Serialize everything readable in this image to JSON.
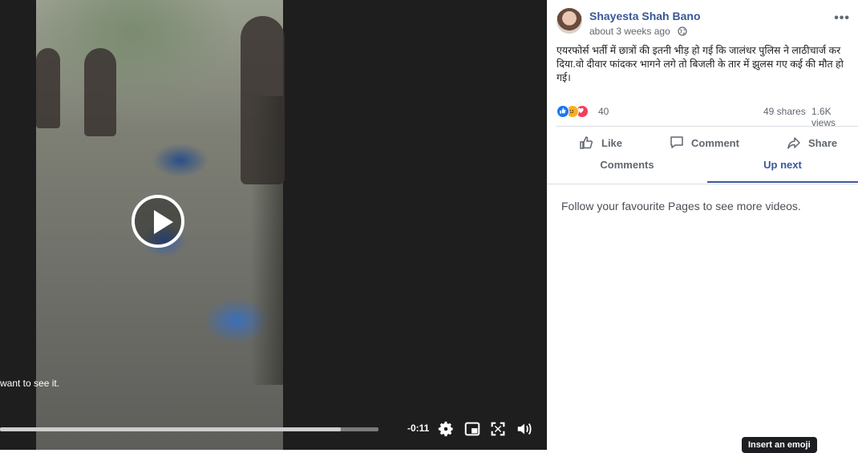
{
  "video": {
    "overlay_text": "want to see it.",
    "progress_fraction": 0.9,
    "time_remaining": "-0:11",
    "controls": [
      "settings-icon",
      "picture-in-picture-icon",
      "fullscreen-icon",
      "volume-icon"
    ]
  },
  "post": {
    "author": "Shayesta Shah Bano",
    "timestamp": "about 3 weeks ago",
    "privacy_icon": "globe-icon",
    "text": "एयरफोर्स भर्ती में छात्रों की इतनी भीड़ हो गई कि जालंधर पुलिस ने लाठीचार्ज कर दिया.वो दीवार फांदकर भागने लगे तो बिजली के तार में झुलस गए कई की मौत हो गई।",
    "reactions": [
      "like-reaction-icon",
      "sad-reaction-icon",
      "love-reaction-icon"
    ],
    "reaction_count": "40",
    "shares": "49 shares",
    "views": "1.6K views"
  },
  "actions": {
    "like": "Like",
    "comment": "Comment",
    "share": "Share"
  },
  "tabs": {
    "comments": "Comments",
    "up_next": "Up next"
  },
  "up_next": {
    "message": "Follow your favourite Pages to see more videos."
  },
  "tooltip": {
    "text": "Insert an emoji"
  },
  "colors": {
    "brand": "#385898",
    "text_secondary": "#606770",
    "video_bg": "#1e1e1e"
  }
}
